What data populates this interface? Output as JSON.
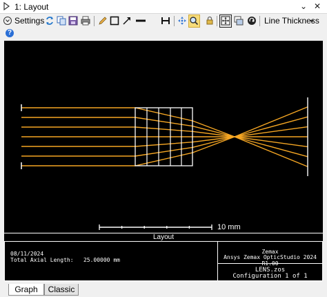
{
  "window": {
    "title": "1: Layout",
    "pin_glyph": "⌄",
    "close_glyph": "✕"
  },
  "toolbar": {
    "settings_label": "Settings",
    "line_thickness_label": "Line Thickness"
  },
  "viewport": {
    "background": "#000000",
    "ray_color": "#f5a623",
    "lens_color": "#ffffff",
    "scale_bar_label": "10 mm",
    "layout_label": "Layout"
  },
  "info": {
    "date": "08/11/2024",
    "axial_label": "Total Axial Length:",
    "axial_value": "25.00000 mm",
    "company": "Zemax",
    "product": "Ansys Zemax OpticStudio 2024 R1.00",
    "file": "LENS.zos",
    "configuration": "Configuration 1 of 1"
  },
  "tabs": [
    {
      "label": "Graph",
      "selected": true
    },
    {
      "label": "Classic",
      "selected": false
    }
  ]
}
